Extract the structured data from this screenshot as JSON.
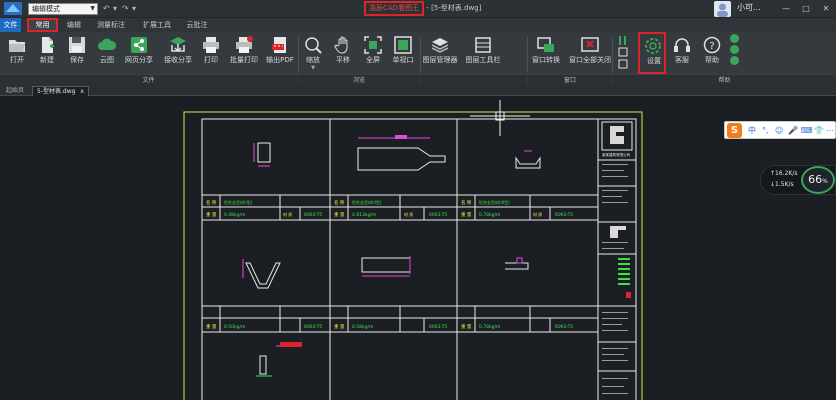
{
  "titlebar": {
    "mode": "编辑模式",
    "app_name": "浩辰CAD看图王",
    "separator": " - ",
    "filename": "[5-型材表.dwg]",
    "user": "小可...",
    "minimize": "—",
    "maximize": "□",
    "close": "✕"
  },
  "menu": {
    "file": "文件",
    "common": "常用",
    "edit": "编辑",
    "measure": "测量标注",
    "extend": "扩展工具",
    "cloud": "云批注"
  },
  "ribbon": {
    "tools": {
      "open": "打开",
      "new": "新建",
      "save": "保存",
      "cloud_map": "云图",
      "web_share": "网页分享",
      "receive_share": "接收分享",
      "print": "打印",
      "batch_print": "批量打印",
      "export_pdf": "输出PDF",
      "zoom": "缩放",
      "pan": "平移",
      "fullscreen": "全屏",
      "single_window": "单视口",
      "layer_manager": "图层管理器",
      "layer_toolbar": "图层工具栏",
      "window_switch": "窗口转换",
      "close_all": "窗口全部关闭",
      "settings": "设置",
      "service": "客服",
      "help": "帮助"
    },
    "groups": {
      "file": "文件",
      "view": "浏览",
      "window": "窗口",
      "help": "帮助"
    }
  },
  "doctabs": {
    "start": "起始页",
    "current": "5-型材表.dwg",
    "close": "x"
  },
  "cad": {
    "row1_name_label": "名 称",
    "row1_weight_label": "重 量",
    "row1_material_label": "材 质",
    "row1_material": "6063-T5",
    "row1_weights": [
      "0.48kg/m",
      "4.813kg/m",
      "0.78kg/m"
    ],
    "row1_names": [
      "铝合金型材(I型)",
      "铝合金型材(II型)",
      "铝合金型材(III型)"
    ],
    "row2_weights": [
      "0.50kg/m",
      "0.58kg/m",
      "0.78kg/m"
    ],
    "title_block_company": "某某建筑有限公司",
    "project_label": "工 程 名 称"
  },
  "ime": {
    "logo": "S",
    "items": [
      "中",
      "°,",
      "☺",
      "🎤",
      "⌨",
      "👕",
      "⋯"
    ]
  },
  "speed": {
    "up": "↑16.2",
    "up_unit": "K/s",
    "down": "↓1.5",
    "down_unit": "K/s",
    "percent": "66",
    "percent_unit": "%"
  }
}
